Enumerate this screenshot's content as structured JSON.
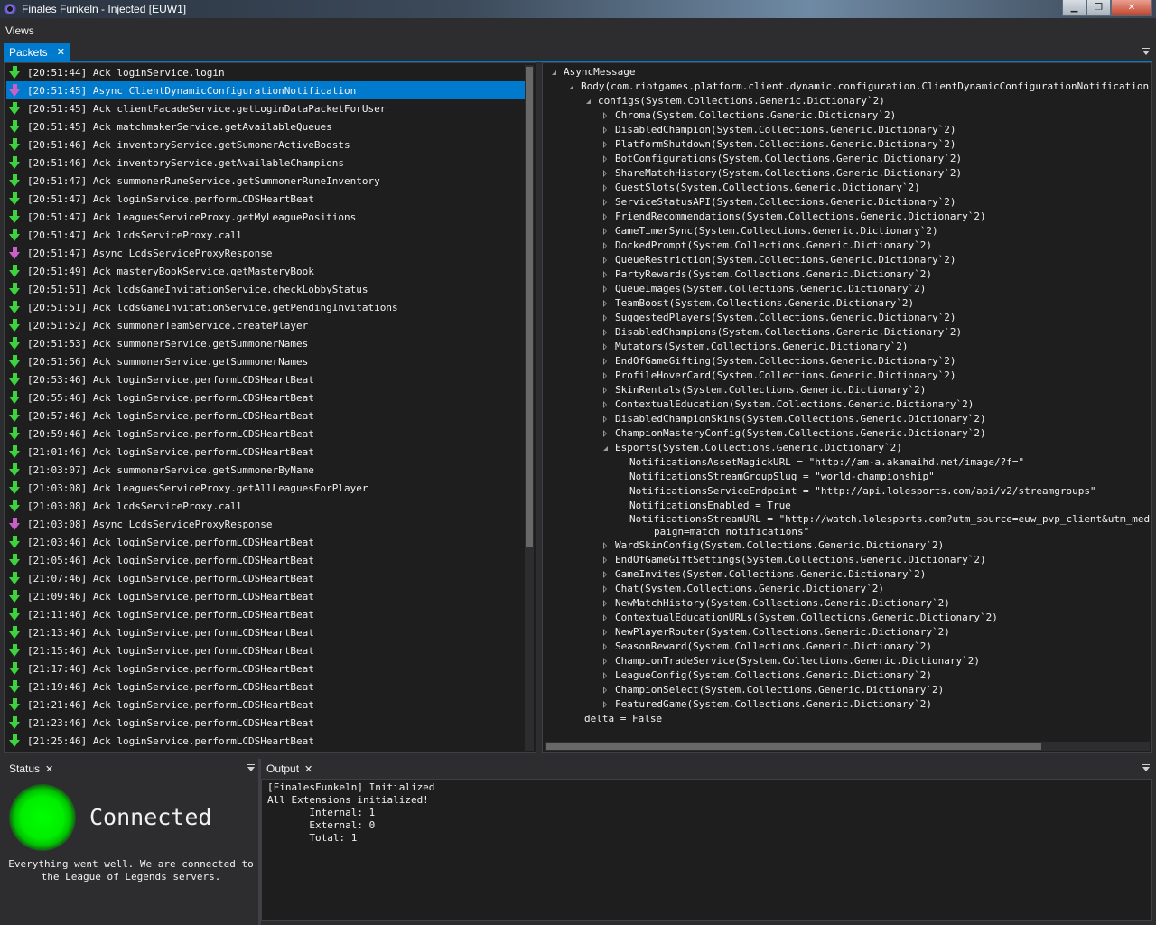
{
  "window": {
    "title": "Finales Funkeln - Injected [EUW1]",
    "minimize": "▁",
    "maximize": "❐",
    "close": "✕"
  },
  "menu": {
    "views": "Views"
  },
  "tabs": {
    "packets": "Packets",
    "close": "✕"
  },
  "packets": [
    {
      "time": "[20:51:44]",
      "type": "Ack",
      "name": "loginService.login"
    },
    {
      "time": "[20:51:45]",
      "type": "Async",
      "name": "ClientDynamicConfigurationNotification",
      "selected": true
    },
    {
      "time": "[20:51:45]",
      "type": "Ack",
      "name": "clientFacadeService.getLoginDataPacketForUser"
    },
    {
      "time": "[20:51:45]",
      "type": "Ack",
      "name": "matchmakerService.getAvailableQueues"
    },
    {
      "time": "[20:51:46]",
      "type": "Ack",
      "name": "inventoryService.getSumonerActiveBoosts"
    },
    {
      "time": "[20:51:46]",
      "type": "Ack",
      "name": "inventoryService.getAvailableChampions"
    },
    {
      "time": "[20:51:47]",
      "type": "Ack",
      "name": "summonerRuneService.getSummonerRuneInventory"
    },
    {
      "time": "[20:51:47]",
      "type": "Ack",
      "name": "loginService.performLCDSHeartBeat"
    },
    {
      "time": "[20:51:47]",
      "type": "Ack",
      "name": "leaguesServiceProxy.getMyLeaguePositions"
    },
    {
      "time": "[20:51:47]",
      "type": "Ack",
      "name": "lcdsServiceProxy.call"
    },
    {
      "time": "[20:51:47]",
      "type": "Async",
      "name": "LcdsServiceProxyResponse"
    },
    {
      "time": "[20:51:49]",
      "type": "Ack",
      "name": "masteryBookService.getMasteryBook"
    },
    {
      "time": "[20:51:51]",
      "type": "Ack",
      "name": "lcdsGameInvitationService.checkLobbyStatus"
    },
    {
      "time": "[20:51:51]",
      "type": "Ack",
      "name": "lcdsGameInvitationService.getPendingInvitations"
    },
    {
      "time": "[20:51:52]",
      "type": "Ack",
      "name": "summonerTeamService.createPlayer"
    },
    {
      "time": "[20:51:53]",
      "type": "Ack",
      "name": "summonerService.getSummonerNames"
    },
    {
      "time": "[20:51:56]",
      "type": "Ack",
      "name": "summonerService.getSummonerNames"
    },
    {
      "time": "[20:53:46]",
      "type": "Ack",
      "name": "loginService.performLCDSHeartBeat"
    },
    {
      "time": "[20:55:46]",
      "type": "Ack",
      "name": "loginService.performLCDSHeartBeat"
    },
    {
      "time": "[20:57:46]",
      "type": "Ack",
      "name": "loginService.performLCDSHeartBeat"
    },
    {
      "time": "[20:59:46]",
      "type": "Ack",
      "name": "loginService.performLCDSHeartBeat"
    },
    {
      "time": "[21:01:46]",
      "type": "Ack",
      "name": "loginService.performLCDSHeartBeat"
    },
    {
      "time": "[21:03:07]",
      "type": "Ack",
      "name": "summonerService.getSummonerByName"
    },
    {
      "time": "[21:03:08]",
      "type": "Ack",
      "name": "leaguesServiceProxy.getAllLeaguesForPlayer"
    },
    {
      "time": "[21:03:08]",
      "type": "Ack",
      "name": "lcdsServiceProxy.call"
    },
    {
      "time": "[21:03:08]",
      "type": "Async",
      "name": "LcdsServiceProxyResponse"
    },
    {
      "time": "[21:03:46]",
      "type": "Ack",
      "name": "loginService.performLCDSHeartBeat"
    },
    {
      "time": "[21:05:46]",
      "type": "Ack",
      "name": "loginService.performLCDSHeartBeat"
    },
    {
      "time": "[21:07:46]",
      "type": "Ack",
      "name": "loginService.performLCDSHeartBeat"
    },
    {
      "time": "[21:09:46]",
      "type": "Ack",
      "name": "loginService.performLCDSHeartBeat"
    },
    {
      "time": "[21:11:46]",
      "type": "Ack",
      "name": "loginService.performLCDSHeartBeat"
    },
    {
      "time": "[21:13:46]",
      "type": "Ack",
      "name": "loginService.performLCDSHeartBeat"
    },
    {
      "time": "[21:15:46]",
      "type": "Ack",
      "name": "loginService.performLCDSHeartBeat"
    },
    {
      "time": "[21:17:46]",
      "type": "Ack",
      "name": "loginService.performLCDSHeartBeat"
    },
    {
      "time": "[21:19:46]",
      "type": "Ack",
      "name": "loginService.performLCDSHeartBeat"
    },
    {
      "time": "[21:21:46]",
      "type": "Ack",
      "name": "loginService.performLCDSHeartBeat"
    },
    {
      "time": "[21:23:46]",
      "type": "Ack",
      "name": "loginService.performLCDSHeartBeat"
    },
    {
      "time": "[21:25:46]",
      "type": "Ack",
      "name": "loginService.performLCDSHeartBeat"
    }
  ],
  "tree": [
    {
      "level": 0,
      "exp": "expanded",
      "text": "AsyncMessage"
    },
    {
      "level": 1,
      "exp": "expanded",
      "text": "Body(com.riotgames.platform.client.dynamic.configuration.ClientDynamicConfigurationNotification)"
    },
    {
      "level": 2,
      "exp": "expanded",
      "text": "configs(System.Collections.Generic.Dictionary`2)"
    },
    {
      "level": 3,
      "exp": "collapsed",
      "text": "Chroma(System.Collections.Generic.Dictionary`2)"
    },
    {
      "level": 3,
      "exp": "collapsed",
      "text": "DisabledChampion(System.Collections.Generic.Dictionary`2)"
    },
    {
      "level": 3,
      "exp": "collapsed",
      "text": "PlatformShutdown(System.Collections.Generic.Dictionary`2)"
    },
    {
      "level": 3,
      "exp": "collapsed",
      "text": "BotConfigurations(System.Collections.Generic.Dictionary`2)"
    },
    {
      "level": 3,
      "exp": "collapsed",
      "text": "ShareMatchHistory(System.Collections.Generic.Dictionary`2)"
    },
    {
      "level": 3,
      "exp": "collapsed",
      "text": "GuestSlots(System.Collections.Generic.Dictionary`2)"
    },
    {
      "level": 3,
      "exp": "collapsed",
      "text": "ServiceStatusAPI(System.Collections.Generic.Dictionary`2)"
    },
    {
      "level": 3,
      "exp": "collapsed",
      "text": "FriendRecommendations(System.Collections.Generic.Dictionary`2)"
    },
    {
      "level": 3,
      "exp": "collapsed",
      "text": "GameTimerSync(System.Collections.Generic.Dictionary`2)"
    },
    {
      "level": 3,
      "exp": "collapsed",
      "text": "DockedPrompt(System.Collections.Generic.Dictionary`2)"
    },
    {
      "level": 3,
      "exp": "collapsed",
      "text": "QueueRestriction(System.Collections.Generic.Dictionary`2)"
    },
    {
      "level": 3,
      "exp": "collapsed",
      "text": "PartyRewards(System.Collections.Generic.Dictionary`2)"
    },
    {
      "level": 3,
      "exp": "collapsed",
      "text": "QueueImages(System.Collections.Generic.Dictionary`2)"
    },
    {
      "level": 3,
      "exp": "collapsed",
      "text": "TeamBoost(System.Collections.Generic.Dictionary`2)"
    },
    {
      "level": 3,
      "exp": "collapsed",
      "text": "SuggestedPlayers(System.Collections.Generic.Dictionary`2)"
    },
    {
      "level": 3,
      "exp": "collapsed",
      "text": "DisabledChampions(System.Collections.Generic.Dictionary`2)"
    },
    {
      "level": 3,
      "exp": "collapsed",
      "text": "Mutators(System.Collections.Generic.Dictionary`2)"
    },
    {
      "level": 3,
      "exp": "collapsed",
      "text": "EndOfGameGifting(System.Collections.Generic.Dictionary`2)"
    },
    {
      "level": 3,
      "exp": "collapsed",
      "text": "ProfileHoverCard(System.Collections.Generic.Dictionary`2)"
    },
    {
      "level": 3,
      "exp": "collapsed",
      "text": "SkinRentals(System.Collections.Generic.Dictionary`2)"
    },
    {
      "level": 3,
      "exp": "collapsed",
      "text": "ContextualEducation(System.Collections.Generic.Dictionary`2)"
    },
    {
      "level": 3,
      "exp": "collapsed",
      "text": "DisabledChampionSkins(System.Collections.Generic.Dictionary`2)"
    },
    {
      "level": 3,
      "exp": "collapsed",
      "text": "ChampionMasteryConfig(System.Collections.Generic.Dictionary`2)"
    },
    {
      "level": 3,
      "exp": "expanded",
      "text": "Esports(System.Collections.Generic.Dictionary`2)"
    },
    {
      "level": 4,
      "exp": "none",
      "text": "NotificationsAssetMagickURL = \"http://am-a.akamaihd.net/image/?f=\""
    },
    {
      "level": 4,
      "exp": "none",
      "text": "NotificationsStreamGroupSlug = \"world-championship\""
    },
    {
      "level": 4,
      "exp": "none",
      "text": "NotificationsServiceEndpoint = \"http://api.lolesports.com/api/v2/streamgroups\""
    },
    {
      "level": 4,
      "exp": "none",
      "text": "NotificationsEnabled = True"
    },
    {
      "level": 4,
      "exp": "none",
      "text": "NotificationsStreamURL = \"http://watch.lolesports.com?utm_source=euw_pvp_client&utm_medi",
      "wrap": true
    },
    {
      "level": 5,
      "exp": "none",
      "text": "paign=match_notifications\"",
      "wrap": true
    },
    {
      "level": 3,
      "exp": "collapsed",
      "text": "WardSkinConfig(System.Collections.Generic.Dictionary`2)"
    },
    {
      "level": 3,
      "exp": "collapsed",
      "text": "EndOfGameGiftSettings(System.Collections.Generic.Dictionary`2)"
    },
    {
      "level": 3,
      "exp": "collapsed",
      "text": "GameInvites(System.Collections.Generic.Dictionary`2)"
    },
    {
      "level": 3,
      "exp": "collapsed",
      "text": "Chat(System.Collections.Generic.Dictionary`2)"
    },
    {
      "level": 3,
      "exp": "collapsed",
      "text": "NewMatchHistory(System.Collections.Generic.Dictionary`2)"
    },
    {
      "level": 3,
      "exp": "collapsed",
      "text": "ContextualEducationURLs(System.Collections.Generic.Dictionary`2)"
    },
    {
      "level": 3,
      "exp": "collapsed",
      "text": "NewPlayerRouter(System.Collections.Generic.Dictionary`2)"
    },
    {
      "level": 3,
      "exp": "collapsed",
      "text": "SeasonReward(System.Collections.Generic.Dictionary`2)"
    },
    {
      "level": 3,
      "exp": "collapsed",
      "text": "ChampionTradeService(System.Collections.Generic.Dictionary`2)"
    },
    {
      "level": 3,
      "exp": "collapsed",
      "text": "LeagueConfig(System.Collections.Generic.Dictionary`2)"
    },
    {
      "level": 3,
      "exp": "collapsed",
      "text": "ChampionSelect(System.Collections.Generic.Dictionary`2)"
    },
    {
      "level": 3,
      "exp": "collapsed",
      "text": "FeaturedGame(System.Collections.Generic.Dictionary`2)"
    },
    {
      "level": 2,
      "exp": "none",
      "text": "delta = False"
    }
  ],
  "status": {
    "title": "Status",
    "close": "✕",
    "state": "Connected",
    "color": "#00ff00",
    "description_line1": "Everything went well. We are connected to",
    "description_line2": "the League of Legends servers."
  },
  "output": {
    "title": "Output",
    "close": "✕",
    "lines": [
      "[FinalesFunkeln] Initialized",
      "All Extensions initialized!",
      "       Internal: 1",
      "       External: 0",
      "       Total: 1"
    ]
  },
  "colors": {
    "accent": "#007acc",
    "ack_arrow": "#3fd23f",
    "async_arrow": "#c860c8"
  }
}
